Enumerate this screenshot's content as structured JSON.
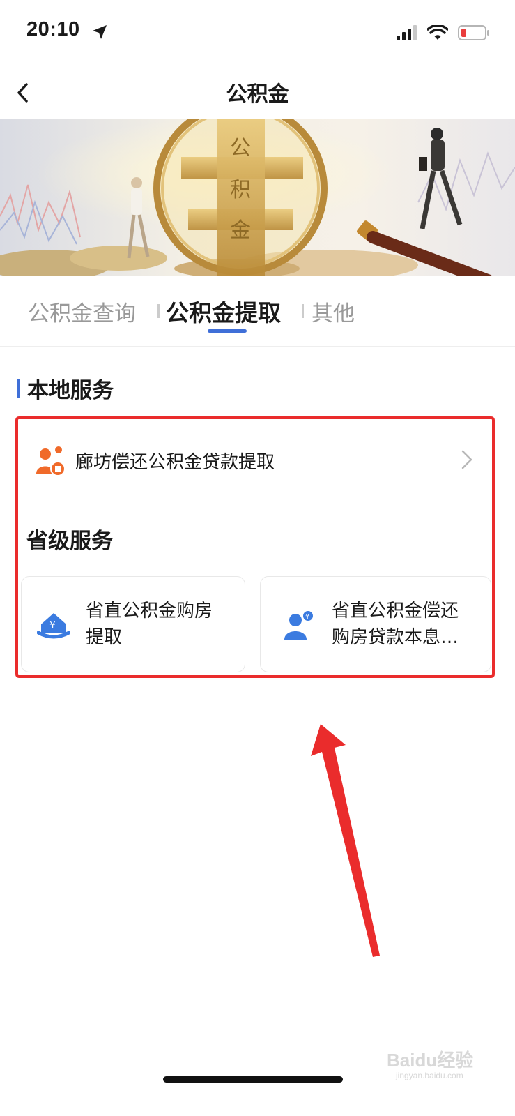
{
  "status": {
    "time": "20:10"
  },
  "nav": {
    "title": "公积金"
  },
  "banner": {
    "magnifier_text": [
      "公",
      "积",
      "金"
    ]
  },
  "tabs": [
    {
      "label": "公积金查询"
    },
    {
      "label": "公积金提取"
    },
    {
      "label": "其他"
    }
  ],
  "local_section": {
    "title": "本地服务",
    "items": [
      {
        "label": "廊坊偿还公积金贷款提取",
        "icon": "person-badge-icon"
      }
    ]
  },
  "provincial_section": {
    "title": "省级服务",
    "cards": [
      {
        "label_line1": "省直公积金购房",
        "label_line2": "提取",
        "icon": "house-yuan-icon"
      },
      {
        "label_line1": "省直公积金偿还",
        "label_line2": "购房贷款本息…",
        "icon": "person-yuan-icon"
      }
    ]
  },
  "watermark": {
    "text": "Baidu经验",
    "sub": "jingyan.baidu.com"
  },
  "colors": {
    "accent": "#3f6fd8",
    "highlight": "#ea2c2c",
    "orange_icon": "#f06a2a",
    "blue_icon": "#3b7be0"
  }
}
